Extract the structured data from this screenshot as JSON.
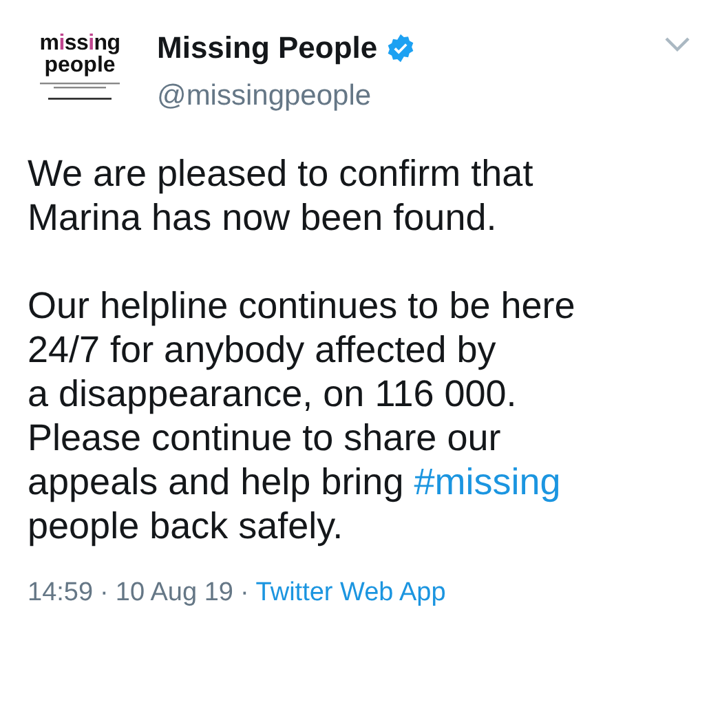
{
  "logo": {
    "line_1": [
      "m",
      "i",
      "ss",
      "i",
      "ng"
    ],
    "line_2": "people"
  },
  "author": {
    "name": "Missing People",
    "verified": true,
    "handle": "@missingpeople"
  },
  "paragraphs": [
    [
      [
        {
          "text": "We are pleased to confirm that",
          "kind": "plain"
        }
      ],
      [
        {
          "text": "Marina has now been found.",
          "kind": "plain"
        }
      ]
    ],
    [
      [
        {
          "text": "Our helpline continues to be here",
          "kind": "plain"
        }
      ],
      [
        {
          "text": "24/7 for anybody affected by",
          "kind": "plain"
        }
      ],
      [
        {
          "text": "a disappearance, on 116 000.",
          "kind": "plain"
        }
      ],
      [
        {
          "text": "Please continue to share our",
          "kind": "plain"
        }
      ],
      [
        {
          "text": "appeals and help bring ",
          "kind": "plain"
        },
        {
          "text": "#missing",
          "kind": "hashtag"
        }
      ],
      [
        {
          "text": "people back safely.",
          "kind": "plain"
        }
      ]
    ]
  ],
  "footer": {
    "time": "14:59",
    "sep_1": "·",
    "date": "10 Aug 19",
    "sep_2": "·",
    "source": "Twitter Web App"
  }
}
